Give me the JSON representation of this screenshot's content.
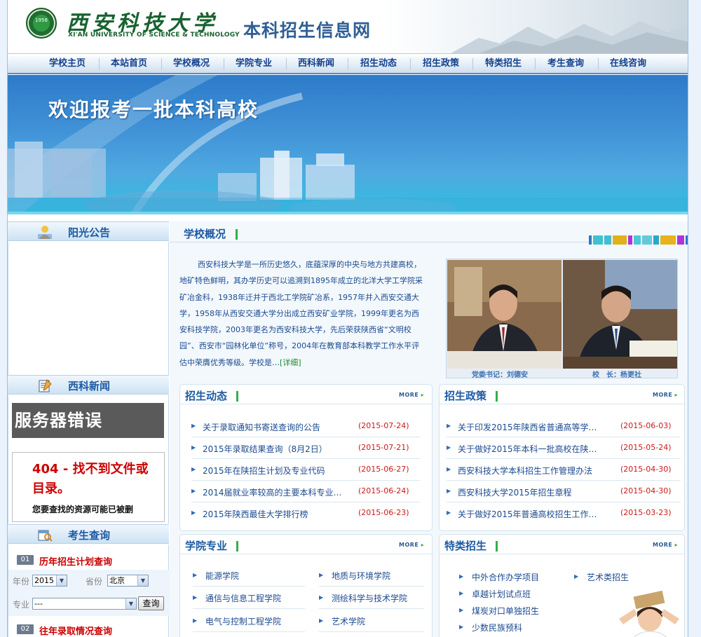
{
  "header": {
    "logo_cn": "西安科技大学",
    "logo_en": "XI'AN UNIVERSITY OF SCIENCE & TECHNOLOGY",
    "seal_text": "1958",
    "site_title": "本科招生信息网"
  },
  "nav": [
    "学校主页",
    "本站首页",
    "学校概况",
    "学院专业",
    "西科新闻",
    "招生动态",
    "招生政策",
    "特类招生",
    "考生查询",
    "在线咨询"
  ],
  "banner": {
    "title": "欢迎报考一批本科高校"
  },
  "left": {
    "notice_title": "阳光公告",
    "news_title": "西科新闻",
    "server_error": "服务器错误",
    "error_title": "404 - 找不到文件或目录。",
    "error_desc": "您要查找的资源可能已被删",
    "query_title": "考生查询",
    "q1": {
      "num": "01",
      "title": "历年招生计划查询"
    },
    "year_label": "年份",
    "year_value": "2015",
    "province_label": "省份",
    "province_value": "北京",
    "major_label": "专业",
    "major_value": "---",
    "query_button": "查询",
    "q2": {
      "num": "02",
      "title": "往年录取情况查询"
    }
  },
  "overview": {
    "title": "学校概况",
    "text": "西安科技大学是一所历史悠久，底蕴深厚的中央与地方共建高校，地矿特色鲜明，其办学历史可以追溯到1895年成立的北洋大学工学院采矿冶金科，1938年迁并于西北工学院矿冶系，1957年并入西安交通大学，1958年从西安交通大学分出成立西安矿业学院，1999年更名为西安科技学院，2003年更名为西安科技大学，先后荣获陕西省“文明校园”、西安市“园林化单位”称号，2004年在教育部本科教学工作水平评估中荣膺优秀等级。学校是…",
    "detail_link": "[详细]",
    "caption_left": "党委书记：刘德安",
    "caption_right": "校　长：杨更社"
  },
  "more_label": "MORE",
  "admission_news": {
    "title": "招生动态",
    "items": [
      {
        "text": "关于录取通知书寄送查询的公告",
        "date": "(2015-07-24)"
      },
      {
        "text": "2015年录取结果查询（8月2日）",
        "date": "(2015-07-21)"
      },
      {
        "text": "2015年在陕招生计划及专业代码",
        "date": "(2015-06-27)"
      },
      {
        "text": "2014届就业率较高的主要本科专业…",
        "date": "(2015-06-24)"
      },
      {
        "text": "2015年陕西最佳大学排行榜",
        "date": "(2015-06-23)"
      }
    ]
  },
  "admission_policy": {
    "title": "招生政策",
    "items": [
      {
        "text": "关于印发2015年陕西省普通高等学…",
        "date": "(2015-06-03)"
      },
      {
        "text": "关于做好2015年本科一批高校在陕…",
        "date": "(2015-05-24)"
      },
      {
        "text": "西安科技大学本科招生工作管理办法",
        "date": "(2015-04-30)"
      },
      {
        "text": "西安科技大学2015年招生章程",
        "date": "(2015-04-30)"
      },
      {
        "text": "关于做好2015年普通高校招生工作…",
        "date": "(2015-03-23)"
      }
    ]
  },
  "colleges": {
    "title": "学院专业",
    "items": [
      "能源学院",
      "地质与环境学院",
      "通信与信息工程学院",
      "测绘科学与技术学院",
      "电气与控制工程学院",
      "艺术学院"
    ]
  },
  "special": {
    "title": "特类招生",
    "items": [
      "中外合作办学项目",
      "艺术类招生",
      "卓越计划试点班",
      "煤炭对口单独招生",
      "少数民族预科"
    ]
  },
  "colors": {
    "primary": "#1d5aa3",
    "accent_green": "#2eb14a",
    "date_red": "#cc1a1a",
    "banner_blue": "#3e8fd6"
  }
}
